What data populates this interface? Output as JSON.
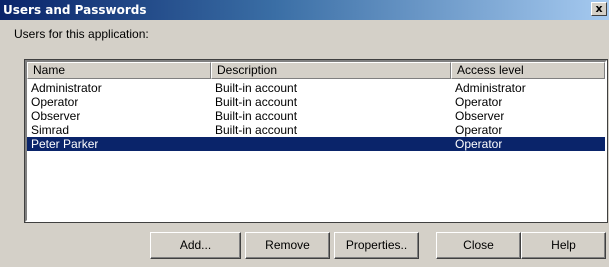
{
  "window": {
    "title": "Users and Passwords",
    "close_glyph": "x"
  },
  "users_label": "Users for this application:",
  "columns": {
    "name": "Name",
    "description": "Description",
    "access": "Access level"
  },
  "users": [
    {
      "name": "Administrator",
      "description": "Built-in account",
      "access": "Administrator"
    },
    {
      "name": "Operator",
      "description": "Built-in account",
      "access": "Operator"
    },
    {
      "name": "Observer",
      "description": "Built-in account",
      "access": "Observer"
    },
    {
      "name": "Simrad",
      "description": "Built-in account",
      "access": "Operator"
    },
    {
      "name": "Peter Parker",
      "description": "",
      "access": "Operator",
      "selected": true
    }
  ],
  "buttons": {
    "add": "Add...",
    "remove": "Remove",
    "properties": "Properties..",
    "close": "Close",
    "help": "Help"
  },
  "colors": {
    "selection": "#0a246a",
    "dialog": "#d4d0c8"
  }
}
